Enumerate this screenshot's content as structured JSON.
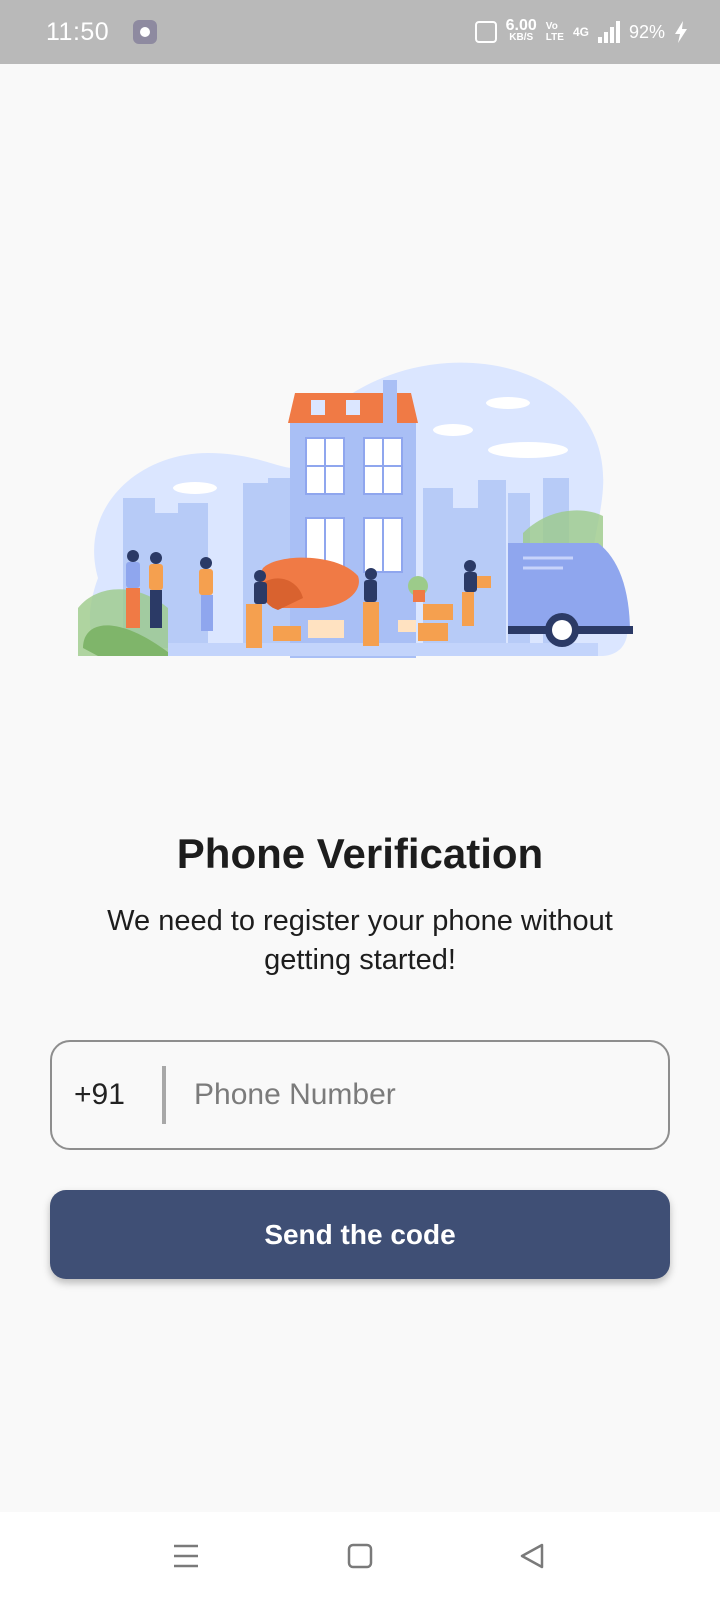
{
  "status_bar": {
    "time": "11:50",
    "net_speed_value": "6.00",
    "net_speed_unit": "KB/S",
    "volte_top": "Vo",
    "volte_bottom": "LTE",
    "network_type": "4G",
    "battery": "92%",
    "icons": [
      "settings-notification-icon",
      "vibrate-icon",
      "signal-icon",
      "charging-icon"
    ]
  },
  "illustration": {
    "description_icon": "moving-house-illustration",
    "colors": {
      "sky": "#dbe6ff",
      "building": "#a9bff5",
      "roof": "#f07a45",
      "accent": "#f5a04f",
      "truck": "#8fa6ee",
      "grass": "#9ccb8a"
    }
  },
  "main": {
    "title": "Phone Verification",
    "subtitle": "We need to register your phone without getting started!",
    "country_code": "+91",
    "phone_placeholder": "Phone Number",
    "phone_value": "",
    "send_button": "Send the code"
  },
  "nav_bar": {
    "icons": [
      "menu-icon",
      "home-icon",
      "back-icon"
    ]
  },
  "colors": {
    "button": "#3f4f75",
    "status_bar": "#b9b9b9",
    "background": "#f9f9f9"
  }
}
